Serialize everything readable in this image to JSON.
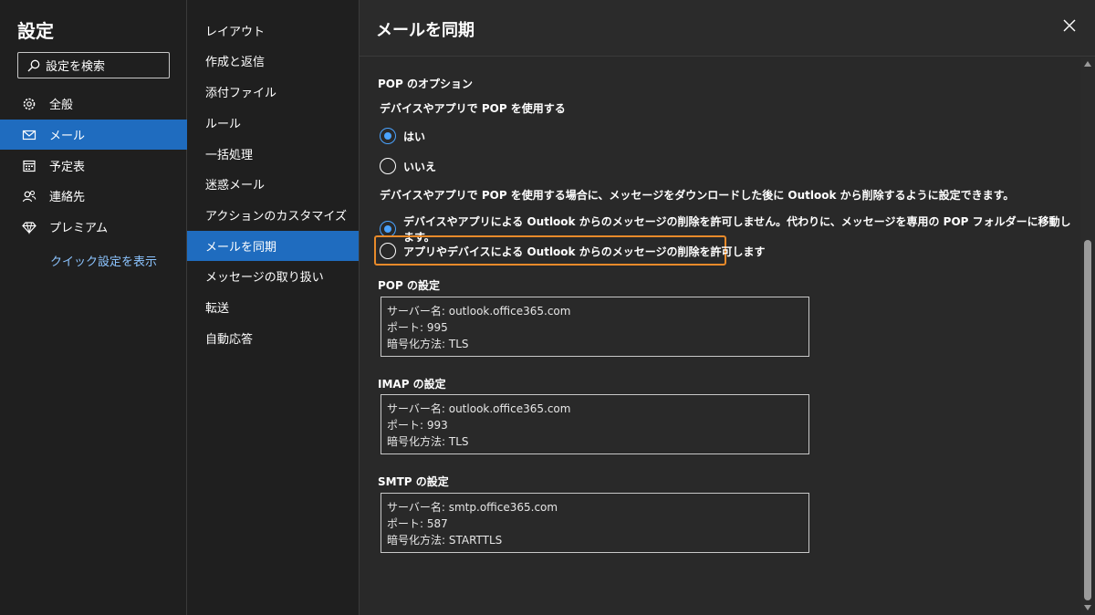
{
  "nav": {
    "title": "設定",
    "search_label": "設定を検索",
    "items": [
      {
        "label": "全般",
        "icon": "gear-icon"
      },
      {
        "label": "メール",
        "icon": "mail-icon"
      },
      {
        "label": "予定表",
        "icon": "calendar-icon"
      },
      {
        "label": "連絡先",
        "icon": "people-icon"
      },
      {
        "label": "プレミアム",
        "icon": "diamond-icon"
      }
    ],
    "quick_settings": "クイック設定を表示"
  },
  "sub": {
    "items": [
      "レイアウト",
      "作成と返信",
      "添付ファイル",
      "ルール",
      "一括処理",
      "迷惑メール",
      "アクションのカスタマイズ",
      "メールを同期",
      "メッセージの取り扱い",
      "転送",
      "自動応答"
    ]
  },
  "main": {
    "title": "メールを同期",
    "pop_options_heading": "POP のオプション",
    "pop_question": "デバイスやアプリで POP を使用する",
    "pop_yes": "はい",
    "pop_no": "いいえ",
    "delete_question": "デバイスやアプリで POP を使用する場合に、メッセージをダウンロードした後に Outlook から削除するように設定できます。",
    "delete_option_1": "デバイスやアプリによる Outlook からのメッセージの削除を許可しません。代わりに、メッセージを専用の POP フォルダーに移動します。",
    "delete_option_2": "アプリやデバイスによる Outlook からのメッセージの削除を許可します",
    "pop_settings": {
      "heading": "POP の設定",
      "server": "サーバー名: outlook.office365.com",
      "port": "ポート: 995",
      "encryption": "暗号化方法: TLS"
    },
    "imap_settings": {
      "heading": "IMAP の設定",
      "server": "サーバー名: outlook.office365.com",
      "port": "ポート: 993",
      "encryption": "暗号化方法: TLS"
    },
    "smtp_settings": {
      "heading": "SMTP の設定",
      "server": "サーバー名: smtp.office365.com",
      "port": "ポート: 587",
      "encryption": "暗号化方法: STARTTLS"
    }
  },
  "colors": {
    "accent": "#1f6cbf",
    "highlight_border": "#e88a2a",
    "radio_checked": "#4aa3ff"
  }
}
